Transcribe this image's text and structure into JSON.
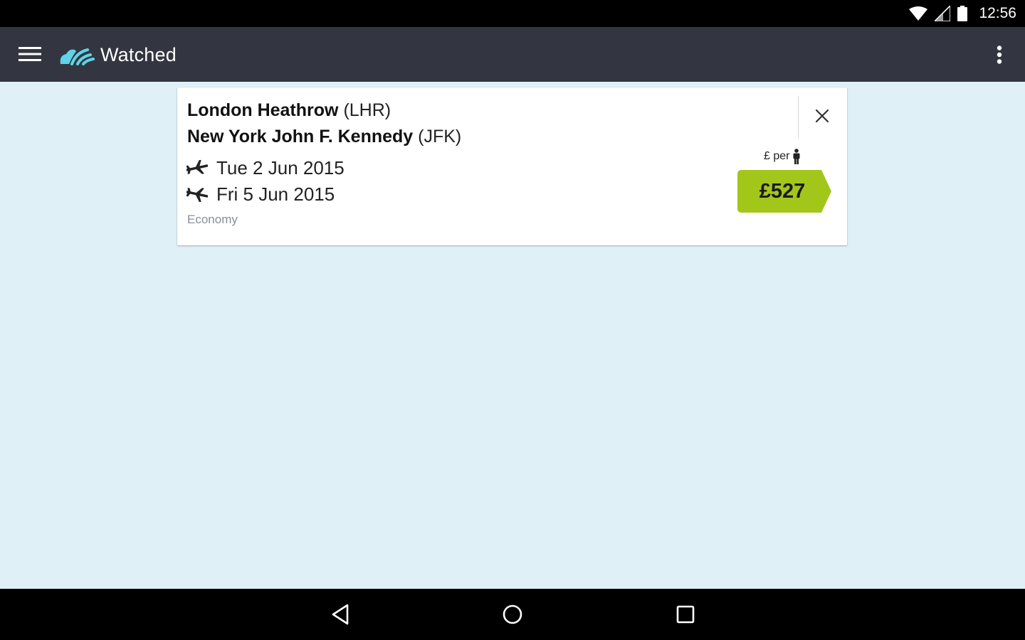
{
  "status_bar": {
    "time": "12:56",
    "icons": [
      "wifi-icon",
      "signal-icon",
      "battery-icon"
    ]
  },
  "app_bar": {
    "title": "Watched",
    "menu_icon": "hamburger-menu-icon",
    "logo_icon": "skyscanner-logo-icon",
    "overflow_icon": "more-vert-icon",
    "background": "#333640"
  },
  "watched_flight": {
    "origin": {
      "name": "London Heathrow",
      "code": "(LHR)"
    },
    "destination": {
      "name": "New York John F. Kennedy",
      "code": "(JFK)"
    },
    "outbound_date": "Tue 2 Jun 2015",
    "return_date": "Fri 5 Jun 2015",
    "cabin_class": "Economy",
    "per_person_label": "£ per",
    "price": "£527",
    "price_color": "#a3c61b",
    "close_icon": "close-icon"
  },
  "nav_bar": {
    "icons": [
      "back-icon",
      "home-icon",
      "recents-icon"
    ]
  }
}
